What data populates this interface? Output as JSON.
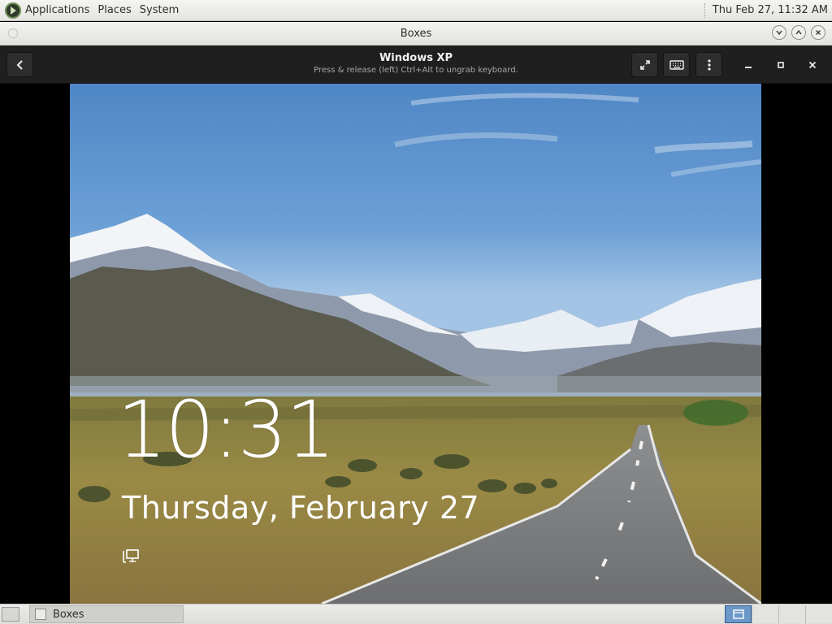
{
  "top_panel": {
    "menus": [
      "Applications",
      "Places",
      "System"
    ],
    "clock": "Thu Feb 27, 11:32 AM"
  },
  "window": {
    "title": "Boxes"
  },
  "header": {
    "vm_name": "Windows XP",
    "hint": "Press & release (left) Ctrl+Alt to ungrab keyboard."
  },
  "lockscreen": {
    "time": "10:31",
    "date": "Thursday, February 27"
  },
  "taskbar": {
    "task_label": "Boxes"
  }
}
